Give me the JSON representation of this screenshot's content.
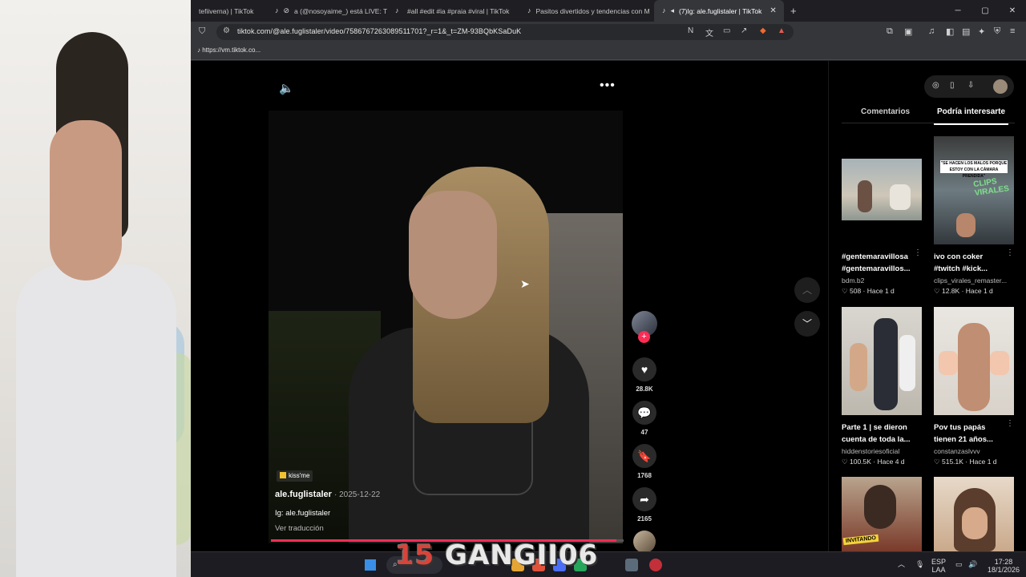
{
  "tabs": [
    {
      "label": "tefiiverna) | TikTok",
      "icon": "tiktok-icon"
    },
    {
      "label": "a (@nosoyaime_) está LIVE: TikTok",
      "icon": "tiktok-icon"
    },
    {
      "label": "#all #edit #ia #praia #viral | TikTok",
      "icon": "tiktok-icon"
    },
    {
      "label": "Pasitos divertidos y tendencias con M",
      "icon": "tiktok-icon"
    },
    {
      "label": "(7)Ig: ale.fuglistaler | TikTok",
      "icon": "tiktok-icon",
      "active": true
    }
  ],
  "window": {
    "minimize": "─",
    "maximize": "▢",
    "close": "✕",
    "new_tab": "+"
  },
  "address": {
    "url": "tiktok.com/@ale.fuglistaler/video/7586767263089511701?_r=1&_t=ZM-93BQbKSaDuK"
  },
  "bookmarks": [
    {
      "label": "https://vm.tiktok.co..."
    }
  ],
  "video": {
    "sticker": "kiss'me",
    "author": "ale.fuglistaler",
    "date": "2025-12-22",
    "caption": "Ig: ale.fuglistaler",
    "translate": "Ver traducción",
    "progress": 0.98
  },
  "actions": {
    "likes": "28.8K",
    "comments": "47",
    "saves": "1768",
    "shares": "2165",
    "follow": "+"
  },
  "sidepanel": {
    "tabs": [
      "Comentarios",
      "Podría interesarte"
    ],
    "selected_tab": "Podría interesarte",
    "cards": [
      {
        "title": "#gentemaravillosa #gentemaravillos...",
        "user": "bdm.b2",
        "likes": "508",
        "age": "Hace 1 d"
      },
      {
        "title": "ivo con coker #twitch #kick...",
        "user": "clips_virales_remaster...",
        "likes": "12.8K",
        "age": "Hace 1 d",
        "overlay": "\"SE HACEN LOS MALOS PORQUE ESTOY CON LA CÁMARA PRENDIDA\"",
        "overlay2": "CLIPS VIRALES"
      },
      {
        "title": "Parte 1 | se dieron cuenta de toda la...",
        "user": "hiddenstoriesoficial",
        "likes": "100.5K",
        "age": "Hace 4 d"
      },
      {
        "title": "Pov tus papás tienen 21 años...",
        "user": "constanzaslvvv",
        "likes": "515.1K",
        "age": "Hace 1 d"
      },
      {
        "title": "",
        "user": "",
        "likes": "",
        "age": "",
        "overlay": "INVITANDO"
      },
      {
        "title": "",
        "user": "",
        "likes": "",
        "age": ""
      }
    ]
  },
  "taskbar": {
    "watermark_num": "15",
    "watermark_text": "GANGII06",
    "lang_top": "ESP",
    "lang_bottom": "LAA",
    "time": "17:28",
    "date": "18/1/2026"
  }
}
